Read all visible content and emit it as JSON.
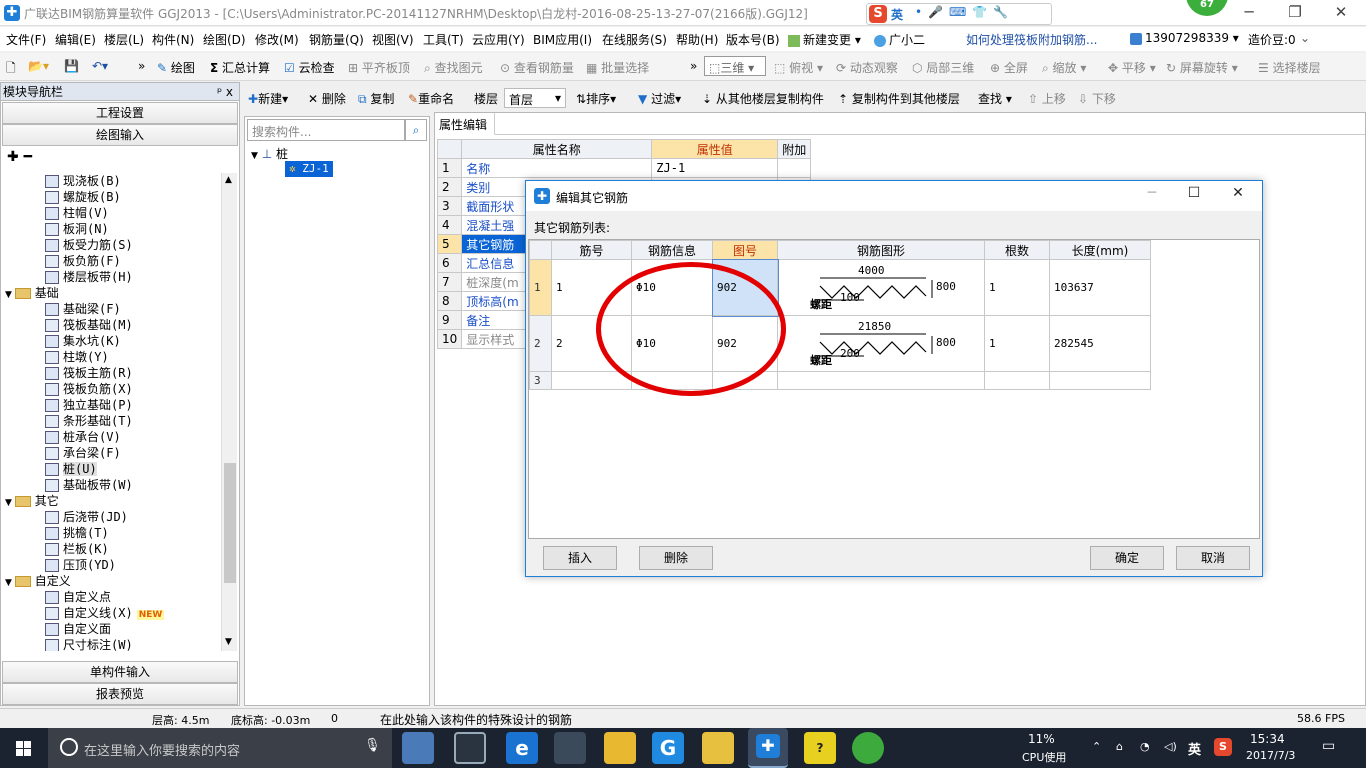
{
  "titlebar": {
    "title": "广联达BIM钢筋算量软件 GGJ2013 - [C:\\Users\\Administrator.PC-20141127NRHM\\Desktop\\白龙村-2016-08-25-13-27-07(2166版).GGJ12]",
    "minimize": "─",
    "maximize": "❐",
    "close": "✕",
    "ime_lang": "英",
    "badge": "67"
  },
  "menu": {
    "items": [
      "文件(F)",
      "编辑(E)",
      "楼层(L)",
      "构件(N)",
      "绘图(D)",
      "修改(M)",
      "钢筋量(Q)",
      "视图(V)",
      "工具(T)",
      "云应用(Y)",
      "BIM应用(I)",
      "在线服务(S)",
      "帮助(H)",
      "版本号(B)",
      "新建变更",
      "广小二"
    ],
    "help_link": "如何处理筏板附加钢筋...",
    "phone": "13907298339",
    "beans": "造价豆:0"
  },
  "toolbar1": {
    "draw": "绘图",
    "summary": "汇总计算",
    "cloud_check": "云检查",
    "align_slab": "平齐板顶",
    "find_element": "查找图元",
    "view_rebar": "查看钢筋量",
    "batch_select": "批量选择",
    "view_mode": "三维",
    "top_view": "俯视",
    "dynamic": "动态观察",
    "local_3d": "局部三维",
    "fullscreen": "全屏",
    "zoom": "缩放",
    "pan": "平移",
    "rotate": "屏幕旋转",
    "select_floor": "选择楼层"
  },
  "nav": {
    "title": "模块导航栏",
    "pin": "ᵖ x",
    "project_settings": "工程设置",
    "draw_input": "绘图输入",
    "single_input": "单构件输入",
    "report": "报表预览",
    "tree": [
      {
        "label": "现浇板(B)",
        "level": 2
      },
      {
        "label": "螺旋板(B)",
        "level": 2
      },
      {
        "label": "柱帽(V)",
        "level": 2
      },
      {
        "label": "板洞(N)",
        "level": 2
      },
      {
        "label": "板受力筋(S)",
        "level": 2
      },
      {
        "label": "板负筋(F)",
        "level": 2
      },
      {
        "label": "楼层板带(H)",
        "level": 2
      },
      {
        "label": "基础",
        "level": 1
      },
      {
        "label": "基础梁(F)",
        "level": 2
      },
      {
        "label": "筏板基础(M)",
        "level": 2
      },
      {
        "label": "集水坑(K)",
        "level": 2
      },
      {
        "label": "柱墩(Y)",
        "level": 2
      },
      {
        "label": "筏板主筋(R)",
        "level": 2
      },
      {
        "label": "筏板负筋(X)",
        "level": 2
      },
      {
        "label": "独立基础(P)",
        "level": 2
      },
      {
        "label": "条形基础(T)",
        "level": 2
      },
      {
        "label": "桩承台(V)",
        "level": 2
      },
      {
        "label": "承台梁(F)",
        "level": 2
      },
      {
        "label": "桩(U)",
        "level": 2
      },
      {
        "label": "基础板带(W)",
        "level": 2
      },
      {
        "label": "其它",
        "level": 1
      },
      {
        "label": "后浇带(JD)",
        "level": 2
      },
      {
        "label": "挑檐(T)",
        "level": 2
      },
      {
        "label": "栏板(K)",
        "level": 2
      },
      {
        "label": "压顶(YD)",
        "level": 2
      },
      {
        "label": "自定义",
        "level": 1
      },
      {
        "label": "自定义点",
        "level": 2
      },
      {
        "label": "自定义线(X)",
        "level": 2
      },
      {
        "label": "自定义面",
        "level": 2
      },
      {
        "label": "尺寸标注(W)",
        "level": 2
      }
    ],
    "new_badge": "NEW"
  },
  "toolbar2": {
    "new": "新建",
    "delete": "删除",
    "copy": "复制",
    "rename": "重命名",
    "floor_label": "楼层",
    "floor_value": "首层",
    "sort": "排序",
    "filter": "过滤",
    "copy_from": "从其他楼层复制构件",
    "copy_to": "复制构件到其他楼层",
    "find": "查找",
    "move_up": "上移",
    "move_down": "下移"
  },
  "component_list": {
    "search_placeholder": "搜索构件...",
    "root": "桩",
    "selected": "ZJ-1"
  },
  "properties": {
    "tab": "属性编辑",
    "headers": [
      "属性名称",
      "属性值",
      "附加"
    ],
    "rows": [
      {
        "n": "1",
        "name": "名称",
        "value": "ZJ-1"
      },
      {
        "n": "2",
        "name": "类别",
        "value": ""
      },
      {
        "n": "3",
        "name": "截面形状",
        "value": ""
      },
      {
        "n": "4",
        "name": "混凝土强",
        "value": ""
      },
      {
        "n": "5",
        "name": "其它钢筋",
        "value": ""
      },
      {
        "n": "6",
        "name": "汇总信息",
        "value": ""
      },
      {
        "n": "7",
        "name": "桩深度(m",
        "value": ""
      },
      {
        "n": "8",
        "name": "顶标高(m",
        "value": ""
      },
      {
        "n": "9",
        "name": "备注",
        "value": ""
      },
      {
        "n": "10",
        "name": "显示样式",
        "value": ""
      }
    ]
  },
  "dialog": {
    "title": "编辑其它钢筋",
    "list_label": "其它钢筋列表:",
    "headers": [
      "",
      "筋号",
      "钢筋信息",
      "图号",
      "钢筋图形",
      "根数",
      "长度(mm)"
    ],
    "rows": [
      {
        "n": "1",
        "no": "1",
        "info": "Φ10",
        "fig": "902",
        "top": "4000",
        "right": "800",
        "spacing_label": "螺距",
        "spacing": "100",
        "count": "1",
        "length": "103637"
      },
      {
        "n": "2",
        "no": "2",
        "info": "Φ10",
        "fig": "902",
        "top": "21850",
        "right": "800",
        "spacing_label": "螺距",
        "spacing": "200",
        "count": "1",
        "length": "282545"
      },
      {
        "n": "3",
        "no": "",
        "info": "",
        "fig": "",
        "top": "",
        "right": "",
        "spacing_label": "",
        "spacing": "",
        "count": "",
        "length": ""
      }
    ],
    "insert": "插入",
    "delete": "删除",
    "ok": "确定",
    "cancel": "取消"
  },
  "status": {
    "floor_height": "层高: 4.5m",
    "bottom_elev": "底标高: -0.03m",
    "zero": "0",
    "hint": "在此处输入该构件的特殊设计的钢筋",
    "fps": "58.6 FPS"
  },
  "taskbar": {
    "search": "在这里输入你要搜索的内容",
    "cpu_percent": "11%",
    "cpu_label": "CPU使用",
    "ime": "英",
    "time": "15:34",
    "date": "2017/7/3"
  },
  "colors": {
    "accent": "#1f7fd8",
    "annotation": "#e20000",
    "selected_row": "#0a64d6",
    "header_highlight": "#fce4a8"
  }
}
